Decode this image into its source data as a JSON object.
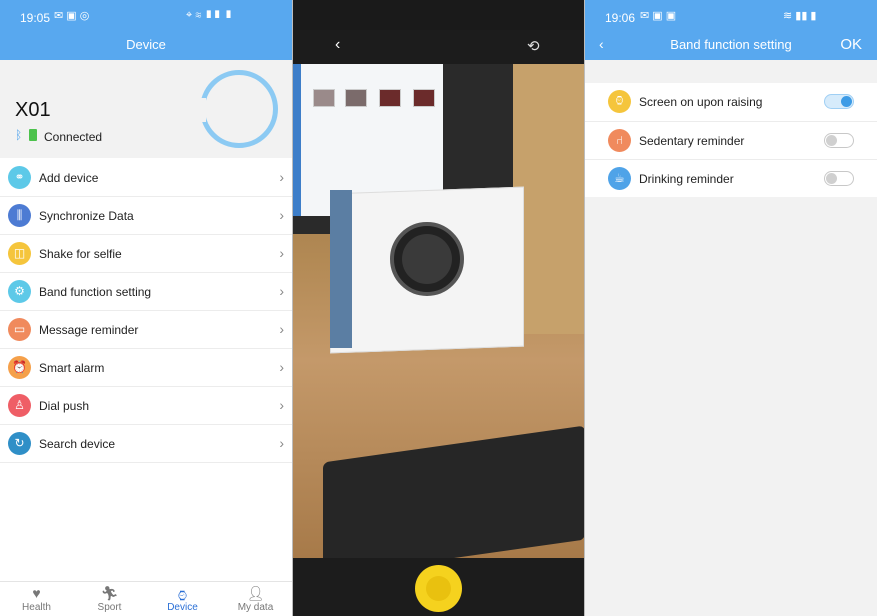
{
  "panel1": {
    "status_time": "19:05",
    "header_title": "Device",
    "device_name": "X01",
    "device_status": "Connected",
    "menu": [
      {
        "label": "Add device",
        "icon": "link-icon",
        "color": "#5dc9e8"
      },
      {
        "label": "Synchronize Data",
        "icon": "sliders-icon",
        "color": "#4d7bd3"
      },
      {
        "label": "Shake for selfie",
        "icon": "shake-icon",
        "color": "#f5c53c"
      },
      {
        "label": "Band function setting",
        "icon": "gear-icon",
        "color": "#5dc9e8"
      },
      {
        "label": "Message reminder",
        "icon": "message-icon",
        "color": "#f08a5d"
      },
      {
        "label": "Smart alarm",
        "icon": "alarm-icon",
        "color": "#f5a04a"
      },
      {
        "label": "Dial push",
        "icon": "shirt-icon",
        "color": "#ef5e66"
      },
      {
        "label": "Search device",
        "icon": "search-device-icon",
        "color": "#2f8fc7"
      }
    ],
    "tabs": [
      {
        "label": "Health",
        "icon": "heart-icon"
      },
      {
        "label": "Sport",
        "icon": "runner-icon"
      },
      {
        "label": "Device",
        "icon": "watch-icon",
        "active": true
      },
      {
        "label": "My data",
        "icon": "person-icon"
      }
    ]
  },
  "panel2": {
    "back_icon": "back-arrow-icon",
    "switch_icon": "camera-switch-icon"
  },
  "panel3": {
    "status_time": "19:06",
    "header_title": "Band function setting",
    "ok_label": "OK",
    "settings": [
      {
        "label": "Screen on upon raising",
        "icon": "watch-raise-icon",
        "color": "#f5c53c",
        "enabled": true
      },
      {
        "label": "Sedentary reminder",
        "icon": "sitting-icon",
        "color": "#f08a5d",
        "enabled": false
      },
      {
        "label": "Drinking reminder",
        "icon": "cup-icon",
        "color": "#4fa3e8",
        "enabled": false
      }
    ]
  },
  "colors": {
    "header_blue": "#58a8ef",
    "active_tab": "#2a6fd6",
    "toggle_on": "#3c9be6"
  }
}
